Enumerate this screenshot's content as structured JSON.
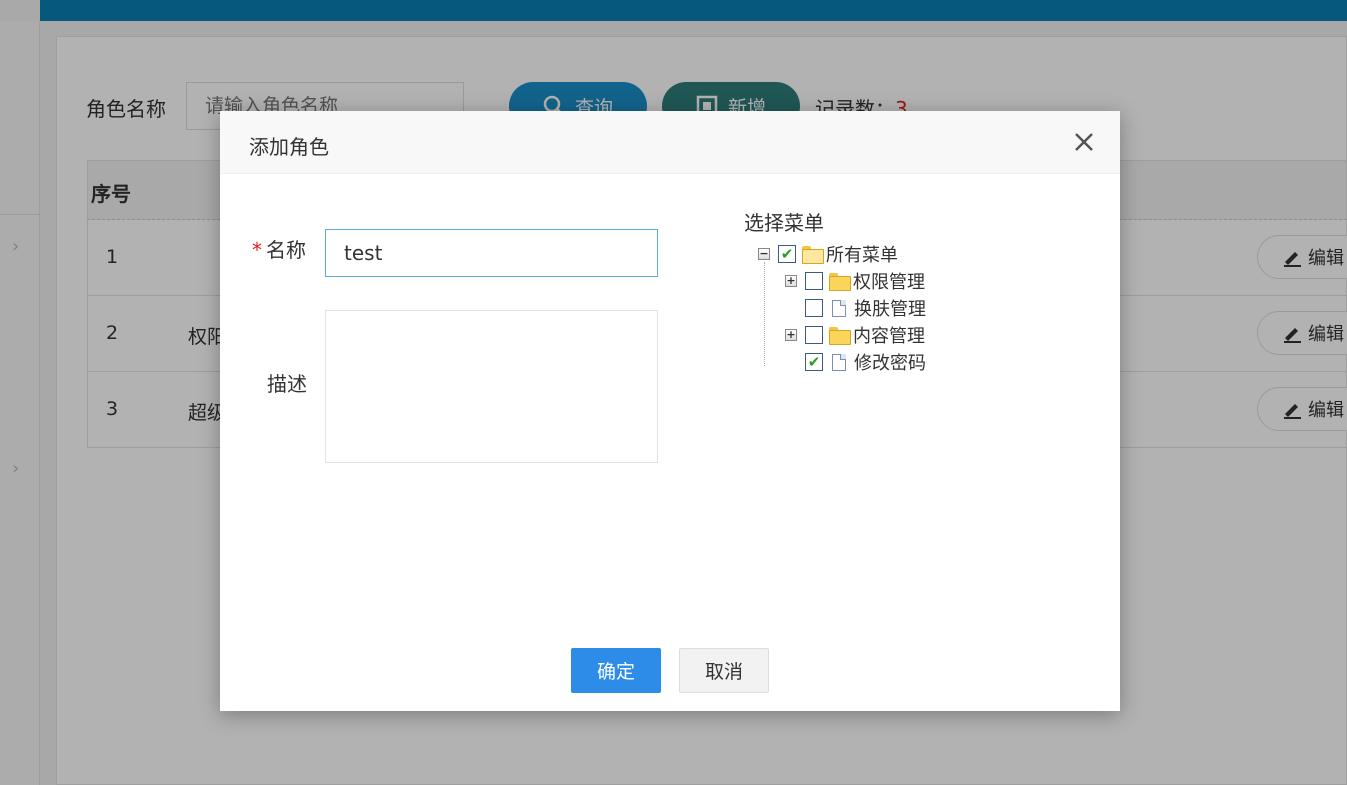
{
  "page": {
    "search": {
      "label": "角色名称",
      "placeholder": "请输入角色名称"
    },
    "buttons": {
      "query": "查询",
      "add": "新增"
    },
    "record": {
      "label": "记录数：",
      "count": "3"
    },
    "table": {
      "header": "序号",
      "rows": [
        {
          "index": "1",
          "name": "",
          "edit": "编辑"
        },
        {
          "index": "2",
          "name": "权阳",
          "edit": "编辑"
        },
        {
          "index": "3",
          "name": "超级",
          "edit": "编辑"
        }
      ]
    }
  },
  "dialog": {
    "title": "添加角色",
    "close_icon": "close-icon",
    "form": {
      "name_label": "名称",
      "required_mark": "*",
      "name_value": "test",
      "desc_label": "描述",
      "desc_value": ""
    },
    "tree": {
      "title": "选择菜单",
      "root": {
        "label": "所有菜单",
        "checked": true,
        "expanded": true
      },
      "children": [
        {
          "label": "权限管理",
          "type": "folder",
          "checked": false,
          "expandable": true
        },
        {
          "label": "换肤管理",
          "type": "file",
          "checked": false,
          "expandable": false
        },
        {
          "label": "内容管理",
          "type": "folder",
          "checked": false,
          "expandable": true
        },
        {
          "label": "修改密码",
          "type": "file",
          "checked": true,
          "expandable": false
        }
      ]
    },
    "buttons": {
      "ok": "确定",
      "cancel": "取消"
    }
  },
  "colors": {
    "topbar": "#0a7fb4",
    "query_button": "#1a8fc8",
    "add_button": "#2f7d7a",
    "ok_button": "#2d8ce8",
    "record_count": "#e02020"
  }
}
